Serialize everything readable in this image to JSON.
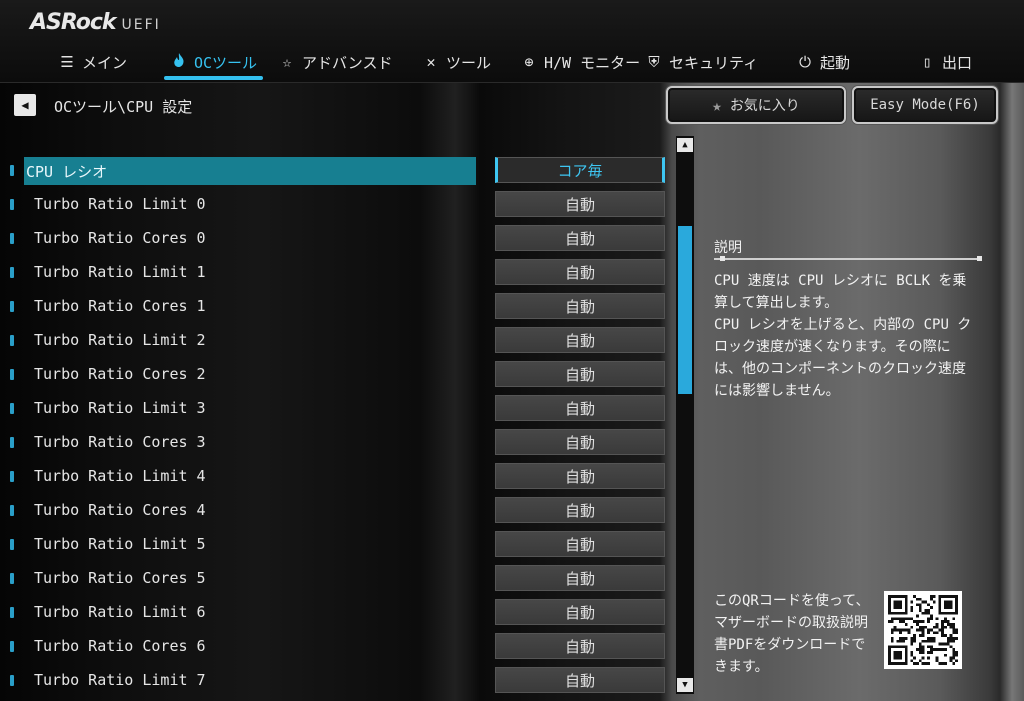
{
  "brand": {
    "logo": "ASRock",
    "suffix": "UEFI"
  },
  "nav": [
    {
      "id": "main",
      "icon": "list-icon",
      "glyph": "☰",
      "label": "メイン"
    },
    {
      "id": "oc",
      "icon": "flame-icon",
      "glyph": "🜂",
      "label": "OCツール",
      "active": true
    },
    {
      "id": "advanced",
      "icon": "star-icon",
      "glyph": "☆",
      "label": "アドバンスド"
    },
    {
      "id": "tools",
      "icon": "tools-icon",
      "glyph": "✕",
      "label": "ツール"
    },
    {
      "id": "hwmon",
      "icon": "crosshair-icon",
      "glyph": "⊕",
      "label": "H/W モニター"
    },
    {
      "id": "security",
      "icon": "shield-icon",
      "glyph": "⛨",
      "label": "セキュリティ"
    },
    {
      "id": "boot",
      "icon": "power-icon",
      "glyph": "⏻",
      "label": "起動"
    },
    {
      "id": "exit",
      "icon": "exit-door-icon",
      "glyph": "⇥",
      "label": "出口"
    }
  ],
  "breadcrumb": "OCツール\\CPU 設定",
  "buttons": {
    "favorites": "お気に入り",
    "easy_mode": "Easy Mode(F6)"
  },
  "settings": [
    {
      "label": "CPU レシオ",
      "value": "コア毎",
      "selected": true
    },
    {
      "label": "Turbo Ratio Limit 0",
      "value": "自動"
    },
    {
      "label": "Turbo Ratio Cores 0",
      "value": "自動"
    },
    {
      "label": "Turbo Ratio Limit 1",
      "value": "自動"
    },
    {
      "label": "Turbo Ratio Cores 1",
      "value": "自動"
    },
    {
      "label": "Turbo Ratio Limit 2",
      "value": "自動"
    },
    {
      "label": "Turbo Ratio Cores 2",
      "value": "自動"
    },
    {
      "label": "Turbo Ratio Limit 3",
      "value": "自動"
    },
    {
      "label": "Turbo Ratio Cores 3",
      "value": "自動"
    },
    {
      "label": "Turbo Ratio Limit 4",
      "value": "自動"
    },
    {
      "label": "Turbo Ratio Cores 4",
      "value": "自動"
    },
    {
      "label": "Turbo Ratio Limit 5",
      "value": "自動"
    },
    {
      "label": "Turbo Ratio Cores 5",
      "value": "自動"
    },
    {
      "label": "Turbo Ratio Limit 6",
      "value": "自動"
    },
    {
      "label": "Turbo Ratio Cores 6",
      "value": "自動"
    },
    {
      "label": "Turbo Ratio Limit 7",
      "value": "自動"
    }
  ],
  "description": {
    "title": "説明",
    "text": "CPU 速度は CPU レシオに BCLK を乗算して算出します。\nCPU レシオを上げると、内部の CPU クロック速度が速くなります。その際には、他のコンポーネントのクロック速度には影響しません。"
  },
  "qr": {
    "text": "このQRコードを使って、マザーボードの取扱説明書PDFをダウンロードできます。"
  },
  "colors": {
    "accent": "#34c0ef",
    "selected_row": "#177f91",
    "scroll_thumb": "#2aa9dc"
  }
}
